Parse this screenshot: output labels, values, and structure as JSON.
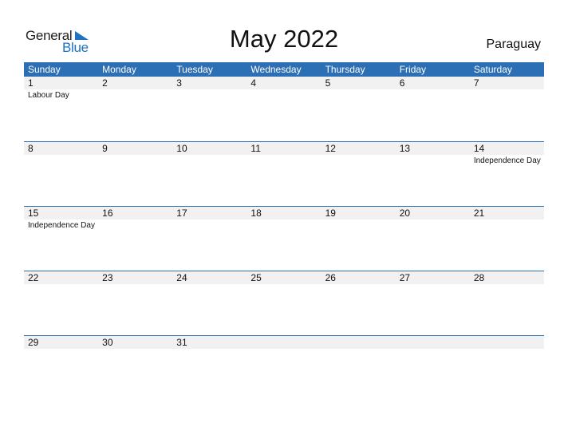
{
  "logo": {
    "line1": "General",
    "line2": "Blue"
  },
  "title": "May 2022",
  "country": "Paraguay",
  "colors": {
    "header": "#2d6fb4",
    "brand": "#1f73c4",
    "row_bg": "#f1f1f1"
  },
  "weekdays": [
    "Sunday",
    "Monday",
    "Tuesday",
    "Wednesday",
    "Thursday",
    "Friday",
    "Saturday"
  ],
  "weeks": [
    {
      "days": [
        "1",
        "2",
        "3",
        "4",
        "5",
        "6",
        "7"
      ],
      "events": [
        "Labour Day",
        "",
        "",
        "",
        "",
        "",
        ""
      ]
    },
    {
      "days": [
        "8",
        "9",
        "10",
        "11",
        "12",
        "13",
        "14"
      ],
      "events": [
        "",
        "",
        "",
        "",
        "",
        "",
        "Independence Day"
      ]
    },
    {
      "days": [
        "15",
        "16",
        "17",
        "18",
        "19",
        "20",
        "21"
      ],
      "events": [
        "Independence Day",
        "",
        "",
        "",
        "",
        "",
        ""
      ]
    },
    {
      "days": [
        "22",
        "23",
        "24",
        "25",
        "26",
        "27",
        "28"
      ],
      "events": [
        "",
        "",
        "",
        "",
        "",
        "",
        ""
      ]
    },
    {
      "days": [
        "29",
        "30",
        "31",
        "",
        "",
        "",
        ""
      ],
      "events": [
        "",
        "",
        "",
        "",
        "",
        "",
        ""
      ]
    }
  ]
}
